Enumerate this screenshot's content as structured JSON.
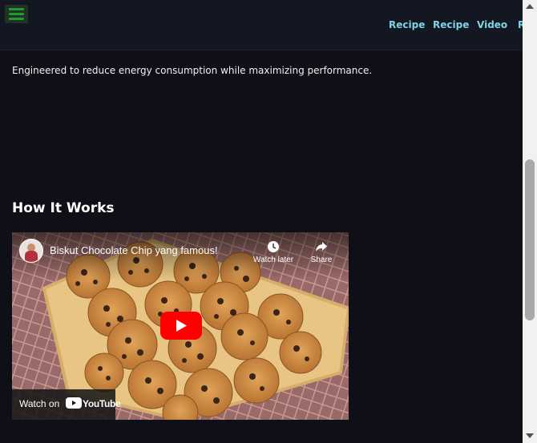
{
  "header": {
    "menu_icon": "hamburger-menu-icon",
    "nav_links": [
      "Recipe",
      "Recipe",
      "Video",
      "R"
    ]
  },
  "main": {
    "tagline": "Engineered to reduce energy consumption while maximizing performance.",
    "section_title": "How It Works",
    "video": {
      "title": "Biskut Chocolate Chip yang famous!",
      "watch_later_label": "Watch later",
      "share_label": "Share",
      "watch_on_label": "Watch on",
      "youtube_label": "YouTube",
      "play_icon": "play-icon"
    }
  },
  "colors": {
    "background": "#0f0f17",
    "header_bg": "#131722",
    "nav_link": "#7fd4e6",
    "menu_icon": "#1e9c2e",
    "youtube_red": "#ff0000"
  }
}
